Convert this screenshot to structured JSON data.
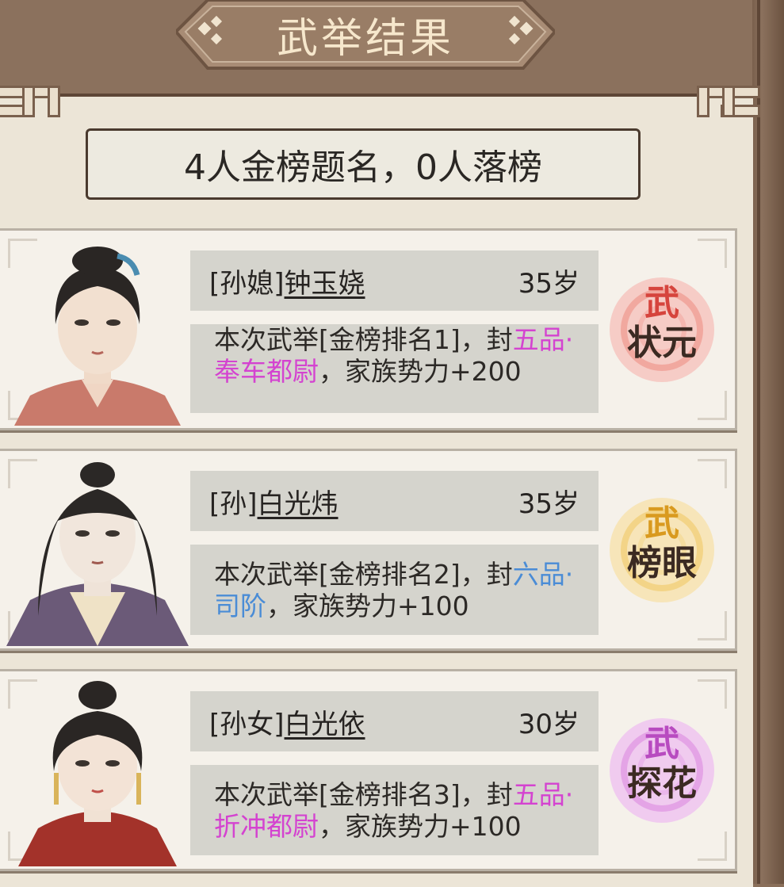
{
  "title": "武举结果",
  "summary": "4人金榜题名，0人落榜",
  "colors": {
    "frame": "#8b715d",
    "panel": "#ece5d7",
    "highlight_pink": "#d443d0",
    "highlight_blue": "#4a8cd6",
    "badge_red": "#f4a9a3",
    "badge_gold": "#f4d88e",
    "badge_purple": "#e39be6"
  },
  "results": [
    {
      "relation": "[孙媳]",
      "name": "钟玉娆",
      "age": "35岁",
      "desc_prefix": "本次武举[金榜排名1]，封",
      "rank_title": "五品·奉车都尉",
      "desc_suffix": "，家族势力+200",
      "badge_line1": "武",
      "badge_line2": "状元",
      "badge_color": "red"
    },
    {
      "relation": "[孙]",
      "name": "白光炜",
      "age": "35岁",
      "desc_prefix": "本次武举[金榜排名2]，封",
      "rank_title": "六品·司阶",
      "desc_suffix": "，家族势力+100",
      "badge_line1": "武",
      "badge_line2": "榜眼",
      "badge_color": "gold"
    },
    {
      "relation": "[孙女]",
      "name": "白光依",
      "age": "30岁",
      "desc_prefix": "本次武举[金榜排名3]，封",
      "rank_title": "五品·折冲都尉",
      "desc_suffix": "，家族势力+100",
      "badge_line1": "武",
      "badge_line2": "探花",
      "badge_color": "purple"
    }
  ]
}
